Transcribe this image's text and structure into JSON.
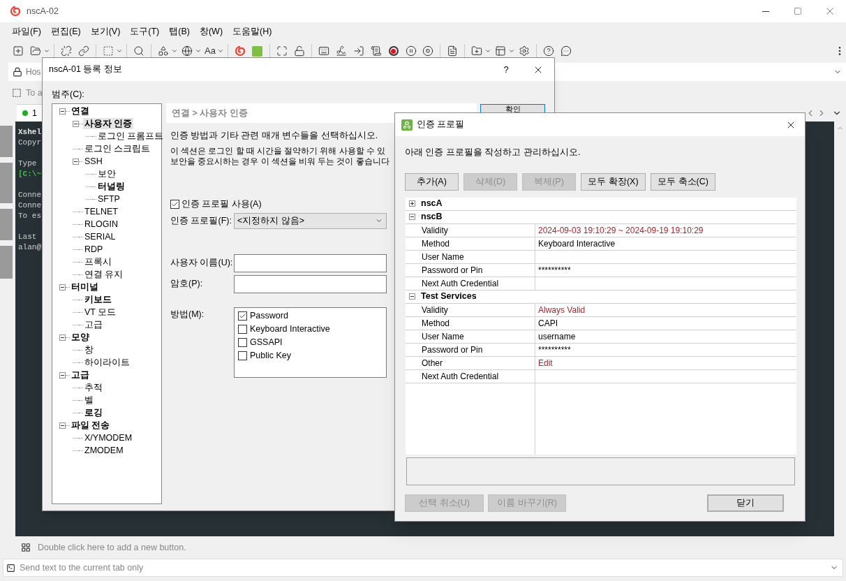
{
  "window": {
    "title": "nscA-02"
  },
  "menu": [
    "파일(F)",
    "편집(E)",
    "보기(V)",
    "도구(T)",
    "탭(B)",
    "창(W)",
    "도움말(H)"
  ],
  "toolbar": {
    "font_button": "Aa"
  },
  "address_bar": {
    "text": "Hos"
  },
  "quick_bar": {
    "text": "To a"
  },
  "session_tab": {
    "label": "1"
  },
  "terminal": {
    "blocks": [
      [
        {
          "text": "Xshel",
          "kind": "bold"
        },
        {
          "text": "Copyr",
          "kind": "plain"
        }
      ],
      [
        {
          "text": "Type",
          "kind": "plain"
        },
        {
          "text": "[C:\\~",
          "kind": "prompt"
        }
      ],
      [
        {
          "text": "Conne",
          "kind": "plain"
        },
        {
          "text": "Conne",
          "kind": "plain"
        },
        {
          "text": "To es",
          "kind": "plain"
        }
      ],
      [
        {
          "text": "Last",
          "kind": "plain"
        },
        {
          "text": "alan@",
          "kind": "plain"
        }
      ]
    ]
  },
  "button_bar": {
    "hint": "Double click here to add a new button."
  },
  "send_bar": {
    "placeholder": "Send text to the current tab only"
  },
  "properties_dialog": {
    "title": "nscA-01 등록 정보",
    "help": "?",
    "category_label": "범주(C):",
    "tree": [
      {
        "label": "연결",
        "bold": true,
        "selected": false,
        "expanded": true,
        "children": [
          {
            "label": "사용자 인증",
            "bold": true,
            "selected": true,
            "expanded": true,
            "children": [
              {
                "label": "로그인 프롬프트",
                "bold": false,
                "selected": false
              }
            ]
          },
          {
            "label": "로그인 스크립트",
            "bold": false,
            "selected": false
          },
          {
            "label": "SSH",
            "bold": false,
            "selected": false,
            "expanded": true,
            "children": [
              {
                "label": "보안",
                "bold": false,
                "selected": false
              },
              {
                "label": "터널링",
                "bold": true,
                "selected": false
              },
              {
                "label": "SFTP",
                "bold": false,
                "selected": false
              }
            ]
          },
          {
            "label": "TELNET",
            "bold": false,
            "selected": false
          },
          {
            "label": "RLOGIN",
            "bold": false,
            "selected": false
          },
          {
            "label": "SERIAL",
            "bold": false,
            "selected": false
          },
          {
            "label": "RDP",
            "bold": false,
            "selected": false
          },
          {
            "label": "프록시",
            "bold": false,
            "selected": false
          },
          {
            "label": "연결 유지",
            "bold": false,
            "selected": false
          }
        ]
      },
      {
        "label": "터미널",
        "bold": true,
        "selected": false,
        "expanded": true,
        "children": [
          {
            "label": "키보드",
            "bold": true,
            "selected": false
          },
          {
            "label": "VT 모드",
            "bold": false,
            "selected": false
          },
          {
            "label": "고급",
            "bold": false,
            "selected": false
          }
        ]
      },
      {
        "label": "모양",
        "bold": true,
        "selected": false,
        "expanded": true,
        "children": [
          {
            "label": "창",
            "bold": false,
            "selected": false
          },
          {
            "label": "하이라이트",
            "bold": false,
            "selected": false
          }
        ]
      },
      {
        "label": "고급",
        "bold": true,
        "selected": false,
        "expanded": true,
        "children": [
          {
            "label": "추적",
            "bold": false,
            "selected": false
          },
          {
            "label": "벨",
            "bold": false,
            "selected": false
          },
          {
            "label": "로깅",
            "bold": true,
            "selected": false
          }
        ]
      },
      {
        "label": "파일 전송",
        "bold": true,
        "selected": false,
        "expanded": true,
        "children": [
          {
            "label": "X/YMODEM",
            "bold": false,
            "selected": false
          },
          {
            "label": "ZMODEM",
            "bold": false,
            "selected": false
          }
        ]
      }
    ],
    "breadcrumb": "연결 > 사용자 인증",
    "description": "인증 방법과 기타 관련 매개 변수들을 선택하십시오.",
    "note_lines": [
      "이 섹션은 로그인 할 때 시간을 절약하기 위해 사용할 수 있",
      "보안을 중요시하는 경우 이 섹션을 비워 두는 것이 좋습니다"
    ],
    "use_profile": {
      "label": "인증 프로필 사용(A)",
      "checked": true
    },
    "profile": {
      "label": "인증 프로필(F):",
      "value": "<지정하지 않음>"
    },
    "username": {
      "label": "사용자 이름(U):"
    },
    "password": {
      "label": "암호(P):"
    },
    "methods": {
      "label": "방법(M):",
      "items": [
        {
          "label": "Password",
          "checked": true
        },
        {
          "label": "Keyboard Interactive",
          "checked": false
        },
        {
          "label": "GSSAPI",
          "checked": false
        },
        {
          "label": "Public Key",
          "checked": false
        }
      ]
    },
    "ok_button": "확인"
  },
  "auth_dialog": {
    "title": "인증 프로필",
    "description": "아래 인증 프로필을 작성하고 관리하십시오.",
    "buttons": [
      {
        "label": "추가(A)",
        "disabled": false
      },
      {
        "label": "삭제(D)",
        "disabled": true
      },
      {
        "label": "복제(P)",
        "disabled": true
      },
      {
        "label": "모두 확장(X)",
        "disabled": false
      },
      {
        "label": "모두 축소(C)",
        "disabled": false
      }
    ],
    "profiles": [
      {
        "name": "nscA",
        "expanded": false
      },
      {
        "name": "nscB",
        "expanded": true,
        "fields": [
          {
            "name": "Validity",
            "value": "2024-09-03 19:10:29 ~ 2024-09-19 19:10:29",
            "color": "#a4262c"
          },
          {
            "name": "Method",
            "value": "Keyboard Interactive"
          },
          {
            "name": "User Name"
          },
          {
            "name": "Password or Pin",
            "value": "**********"
          },
          {
            "name": "Next Auth Credential"
          }
        ]
      },
      {
        "name": "Test Services",
        "expanded": true,
        "fields": [
          {
            "name": "Validity",
            "value": "Always Valid",
            "color": "#a4262c"
          },
          {
            "name": "Method",
            "value": "CAPI"
          },
          {
            "name": "User Name",
            "value": "username"
          },
          {
            "name": "Password or Pin",
            "value": "**********"
          },
          {
            "name": "Other",
            "value": "Edit",
            "color": "#a4262c"
          },
          {
            "name": "Next Auth Credential"
          }
        ]
      }
    ],
    "footer_buttons": [
      {
        "label": "선택 취소(U)",
        "disabled": true,
        "default": false
      },
      {
        "label": "이름 바꾸기(R)",
        "disabled": true,
        "default": false
      },
      {
        "label": "닫기",
        "disabled": false,
        "default": true
      }
    ]
  }
}
